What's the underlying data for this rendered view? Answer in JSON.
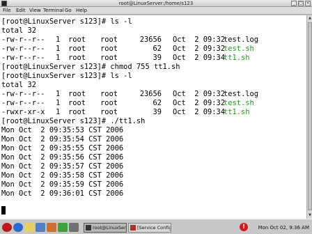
{
  "window": {
    "title": "root@LinuxServer:/home/s123",
    "menu": [
      "File",
      "Edit",
      "View",
      "Terminal",
      "Go",
      "Help"
    ]
  },
  "terminal": {
    "lines": [
      {
        "text": "[root@LinuxServer s123]# ls -l",
        "type": "prompt"
      },
      {
        "text": "total 32",
        "type": "plain"
      },
      {
        "type": "file",
        "perms": "-rw-r--r--",
        "links": "1",
        "owner": "root",
        "group": "root",
        "size": "23656",
        "date": "Oct  2 09:32",
        "name": "test.log",
        "color": "default"
      },
      {
        "type": "file",
        "perms": "-rw-r--r--",
        "links": "1",
        "owner": "root",
        "group": "root",
        "size": "62",
        "date": "Oct  2 09:32",
        "name": "test.sh",
        "color": "green"
      },
      {
        "type": "file",
        "perms": "-rw-r--r--",
        "links": "1",
        "owner": "root",
        "group": "root",
        "size": "39",
        "date": "Oct  2 09:34",
        "name": "tt1.sh",
        "color": "green"
      },
      {
        "text": "[root@LinuxServer s123]# chmod 755 tt1.sh",
        "type": "prompt"
      },
      {
        "text": "[root@LinuxServer s123]# ls -l",
        "type": "prompt"
      },
      {
        "text": "total 32",
        "type": "plain"
      },
      {
        "type": "file",
        "perms": "-rw-r--r--",
        "links": "1",
        "owner": "root",
        "group": "root",
        "size": "23656",
        "date": "Oct  2 09:32",
        "name": "test.log",
        "color": "default"
      },
      {
        "type": "file",
        "perms": "-rw-r--r--",
        "links": "1",
        "owner": "root",
        "group": "root",
        "size": "62",
        "date": "Oct  2 09:32",
        "name": "test.sh",
        "color": "green"
      },
      {
        "type": "file",
        "perms": "-rwxr-xr-x",
        "links": "1",
        "owner": "root",
        "group": "root",
        "size": "39",
        "date": "Oct  2 09:34",
        "name": "tt1.sh",
        "color": "green"
      },
      {
        "text": "[root@LinuxServer s123]# ./tt1.sh",
        "type": "prompt"
      },
      {
        "text": "Mon Oct  2 09:35:53 CST 2006",
        "type": "plain"
      },
      {
        "text": "Mon Oct  2 09:35:54 CST 2006",
        "type": "plain"
      },
      {
        "text": "Mon Oct  2 09:35:55 CST 2006",
        "type": "plain"
      },
      {
        "text": "Mon Oct  2 09:35:56 CST 2006",
        "type": "plain"
      },
      {
        "text": "Mon Oct  2 09:35:57 CST 2006",
        "type": "plain"
      },
      {
        "text": "Mon Oct  2 09:35:58 CST 2006",
        "type": "plain"
      },
      {
        "text": "Mon Oct  2 09:35:59 CST 2006",
        "type": "plain"
      },
      {
        "text": "Mon Oct  2 09:36:01 CST 2006",
        "type": "plain"
      }
    ]
  },
  "taskbar": {
    "launcher_icons": [
      "red-hat-menu-icon",
      "globe-icon",
      "mail-icon",
      "writer-icon",
      "impress-icon",
      "calc-icon",
      "printer-icon"
    ],
    "tasks": [
      {
        "label": "root@LinuxServer",
        "active": true
      },
      {
        "label": "[Service Configu",
        "active": false
      }
    ],
    "alert_icon": "alert-icon",
    "clock": "Mon Oct 02,  9:36 AM"
  }
}
